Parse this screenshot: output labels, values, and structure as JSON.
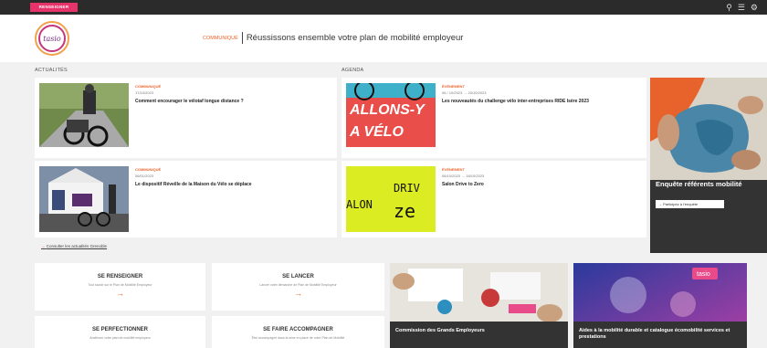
{
  "topbar": {
    "tag_label": "RENSEIGNER",
    "icons": [
      "search-icon",
      "menu-icon",
      "account-icon"
    ]
  },
  "header": {
    "logo_text": "tasio",
    "category": "COMMUNIQUÉ",
    "title": "Réussissons ensemble votre plan de mobilité employeur"
  },
  "sections": {
    "news_label": "ACTUALITÉS",
    "agenda_label": "AGENDA"
  },
  "news": [
    {
      "category": "COMMUNIQUÉ",
      "date": "17/10/2023",
      "title": "Comment encourager le vélotaf longue distance ?"
    },
    {
      "category": "COMMUNIQUÉ",
      "date": "06/01/2023",
      "title": "Le dispositif Réveille de la Maison du Vélo se déplace"
    }
  ],
  "agenda": [
    {
      "category": "ÉVÉNEMENT",
      "date": "06 / 10/2023 → 20/10/2023",
      "title": "Les nouveautés du challenge vélo inter-entreprises RIDE Isère 2023",
      "image_text": [
        "ALLONS-Y",
        "A VÉLO"
      ]
    },
    {
      "category": "ÉVÉNEMENT",
      "date": "06/10/2023 → 18/10/2023",
      "title": "Salon Drive to Zero",
      "image_text": [
        "DRIV",
        "ALON",
        "ze"
      ]
    }
  ],
  "more_news_link": "Consulter les actualités Grenoble",
  "survey": {
    "title": "Enquête référents mobilité",
    "button_label": "Participez à l'enquête"
  },
  "ctas": [
    {
      "title": "SE RENSEIGNER",
      "subtitle": "Tout savoir sur le Plan de Mobilité Employeur"
    },
    {
      "title": "SE LANCER",
      "subtitle": "Lancer votre démarche de Plan de Mobilité Employeur"
    },
    {
      "title": "SE PERFECTIONNER",
      "subtitle": "Améliorer votre plan de mobilité employeur"
    },
    {
      "title": "SE FAIRE ACCOMPAGNER",
      "subtitle": "Être accompagné dans la mise en place de votre Plan de Mobilité"
    }
  ],
  "tiles": [
    {
      "caption": "Commission des Grands Employeurs"
    },
    {
      "caption": "Aides à la mobilité durable et catalogue écomobilité services et prestations",
      "badge": "tasio"
    }
  ],
  "colors": {
    "accent": "#e8632b",
    "brand_pink": "#e8336a",
    "dark": "#333333"
  }
}
